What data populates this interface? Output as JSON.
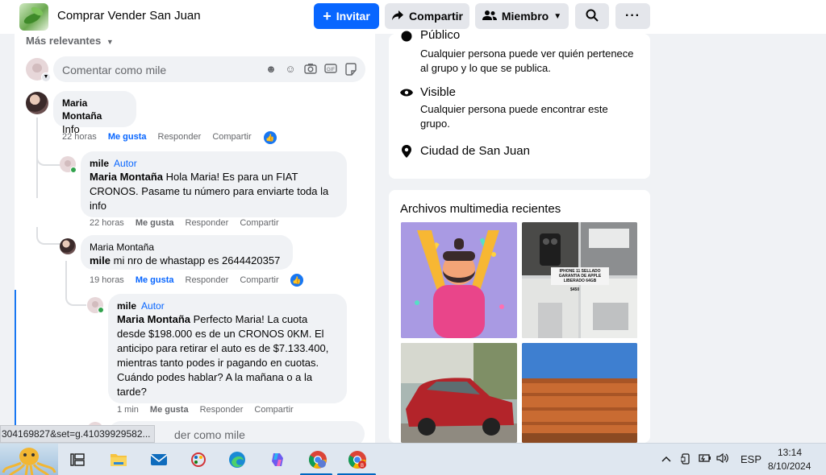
{
  "header": {
    "group_title": "Comprar Vender San Juan",
    "invite_label": "Invitar",
    "share_label": "Compartir",
    "member_label": "Miembro",
    "invite_icon": "plus-icon",
    "share_icon": "share-arrow-icon",
    "member_icon": "people-icon",
    "search_icon": "search-icon",
    "more_icon": "more-icon"
  },
  "comments": {
    "sort_label": "Más relevantes",
    "composer_placeholder": "Comentar como mile",
    "composer_icons": [
      "sticker-smile-icon",
      "emoji-icon",
      "camera-icon",
      "gif-icon",
      "sticker-icon"
    ],
    "items": [
      {
        "author": "Maria Montaña",
        "text": "Info",
        "time": "22 horas",
        "like": "Me gusta",
        "reply": "Responder",
        "share": "Compartir",
        "reactions": "like"
      },
      {
        "author": "mile",
        "badge": "Autor",
        "mention": "Maria Montaña",
        "text": " Hola Maria! Es para un FIAT CRONOS. Pasame tu número para enviarte toda la info",
        "time": "22 horas",
        "like": "Me gusta",
        "reply": "Responder",
        "share": "Compartir"
      },
      {
        "author": "Maria Montaña",
        "mention": "mile",
        "text": " mi nro de whastapp es 2644420357",
        "time": "19 horas",
        "like": "Me gusta",
        "reply": "Responder",
        "share": "Compartir",
        "reactions": "like"
      },
      {
        "author": "mile",
        "badge": "Autor",
        "mention": "Maria Montaña",
        "text": " Perfecto Maria! La cuota desde $198.000 es de un CRONOS 0KM. El anticipo para retirar el auto es de $7.133.400, mientras tanto podes ir pagando en cuotas. Cuándo podes hablar? A la mañana o a la tarde?",
        "time": "1 min",
        "like": "Me gusta",
        "reply": "Responder",
        "share": "Compartir"
      }
    ],
    "reply_placeholder": "der como mile"
  },
  "status_url": "304169827&set=g.41039929582...",
  "about": {
    "public_title": "Público",
    "public_desc": "Cualquier persona puede ver quién pertenece al grupo y lo que se publica.",
    "visible_title": "Visible",
    "visible_desc": "Cualquier persona puede encontrar este grupo.",
    "location": "Ciudad de San Juan"
  },
  "media": {
    "title": "Archivos multimedia recientes",
    "tile2_caption": "IPHONE 11 SELLADO GARANTIA DE APPLE LIBERADO 64GB",
    "tile2_price": "$450"
  },
  "taskbar": {
    "apps": [
      "octopus-wallpaper-icon",
      "task-view-icon",
      "file-explorer-icon",
      "mail-icon",
      "paint-icon",
      "edge-icon",
      "copilot-icon",
      "chrome-icon",
      "chrome-profile-icon"
    ],
    "language": "ESP",
    "time": "13:14",
    "date": "8/10/2024"
  },
  "colors": {
    "brand_blue": "#0866ff",
    "like_blue": "#1877f2",
    "online_green": "#31a24c"
  }
}
